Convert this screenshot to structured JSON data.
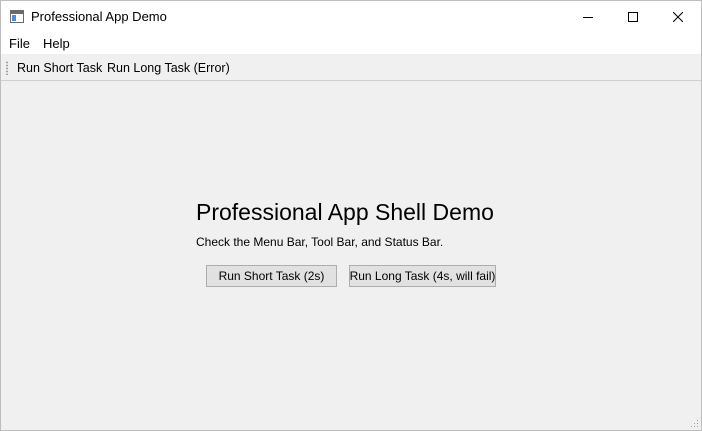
{
  "window": {
    "title": "Professional App Demo",
    "icon": "app-window-icon"
  },
  "titlebar_buttons": {
    "minimize_icon": "minimize-icon",
    "maximize_icon": "maximize-icon",
    "close_icon": "close-icon"
  },
  "menubar": {
    "items": [
      {
        "label": "File"
      },
      {
        "label": "Help"
      }
    ]
  },
  "toolbar": {
    "items": [
      {
        "label": "Run Short Task"
      },
      {
        "label": "Run Long Task (Error)"
      }
    ]
  },
  "main": {
    "heading": "Professional App Shell Demo",
    "subtext": "Check the Menu Bar, Tool Bar, and Status Bar.",
    "buttons": [
      {
        "label": "Run Short Task (2s)"
      },
      {
        "label": "Run Long Task (4s, will fail)"
      }
    ]
  },
  "colors": {
    "window_background": "#f0f0f0",
    "titlebar_background": "#ffffff",
    "button_background": "#e1e1e1",
    "button_border": "#adadad"
  }
}
